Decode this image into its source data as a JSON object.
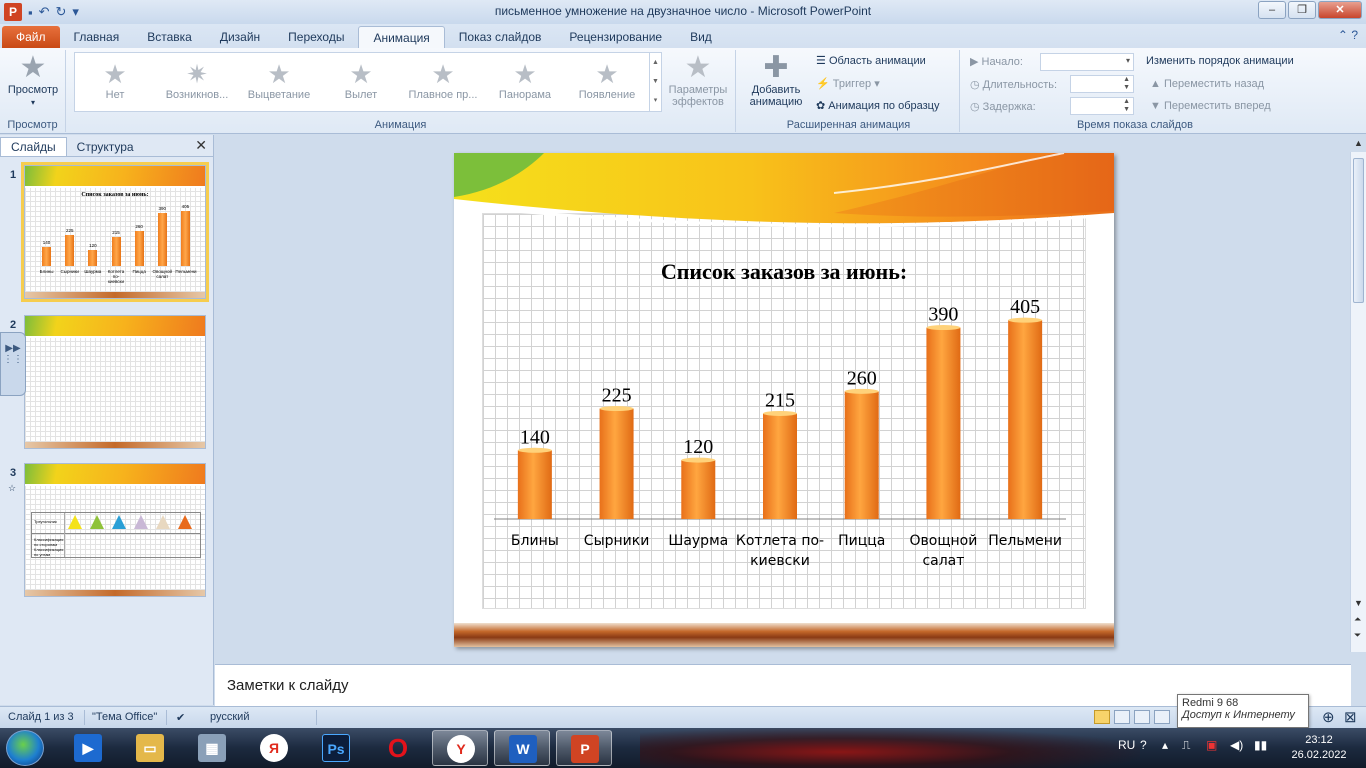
{
  "window": {
    "title": "письменное умножение на двузначное число  -  Microsoft PowerPoint",
    "app_letter": "P"
  },
  "tabs": [
    "Файл",
    "Главная",
    "Вставка",
    "Дизайн",
    "Переходы",
    "Анимация",
    "Показ слайдов",
    "Рецензирование",
    "Вид"
  ],
  "active_tab": "Анимация",
  "ribbon": {
    "preview": {
      "label": "Просмотр",
      "group": "Просмотр"
    },
    "animation_group": "Анимация",
    "gallery": [
      "Нет",
      "Возникнов...",
      "Выцветание",
      "Вылет",
      "Плавное пр...",
      "Панорама",
      "Появление"
    ],
    "effect_params": "Параметры эффектов",
    "advanced": {
      "add_animation": "Добавить анимацию",
      "animation_pane": "Область анимации",
      "trigger": "Триггер",
      "painter": "Анимация по образцу",
      "group": "Расширенная анимация"
    },
    "timing": {
      "start": "Начало:",
      "duration": "Длительность:",
      "delay": "Задержка:",
      "reorder": "Изменить порядок анимации",
      "move_back": "Переместить назад",
      "move_forward": "Переместить вперед",
      "group": "Время показа слайдов"
    }
  },
  "panel": {
    "tab_slides": "Слайды",
    "tab_outline": "Структура",
    "thumbnails": [
      {
        "num": "1",
        "title": "Список заказов за июнь:"
      },
      {
        "num": "2"
      },
      {
        "num": "3",
        "row_header": "Треугольник",
        "row1": "Классификация по сторонам",
        "row2": "Классификация по углам"
      }
    ]
  },
  "slide": {
    "title": "Список заказов за июнь:"
  },
  "chart_data": {
    "type": "bar",
    "title": "Список заказов за июнь:",
    "categories": [
      "Блины",
      "Сырники",
      "Шаурма",
      "Котлета по-киевски",
      "Пицца",
      "Овощной салат",
      "Пельмени"
    ],
    "category_lines": [
      [
        "Блины"
      ],
      [
        "Сырники"
      ],
      [
        "Шаурма"
      ],
      [
        "Котлета по-",
        "киевски"
      ],
      [
        "Пицца"
      ],
      [
        "Овощной",
        "салат"
      ],
      [
        "Пельмени"
      ]
    ],
    "values": [
      140,
      225,
      120,
      215,
      260,
      390,
      405
    ],
    "ylim": [
      0,
      440
    ],
    "data_labels": true,
    "grid": false,
    "color": "#f28a22"
  },
  "notes": {
    "placeholder": "Заметки к слайду"
  },
  "status": {
    "slide": "Слайд 1 из 3",
    "theme": "\"Тема Office\"",
    "language": "русский"
  },
  "tooltip": {
    "line1": "Redmi 9  68",
    "line2": "Доступ к Интернету"
  },
  "tray": {
    "lang": "RU",
    "time": "23:12",
    "date": "26.02.2022"
  }
}
